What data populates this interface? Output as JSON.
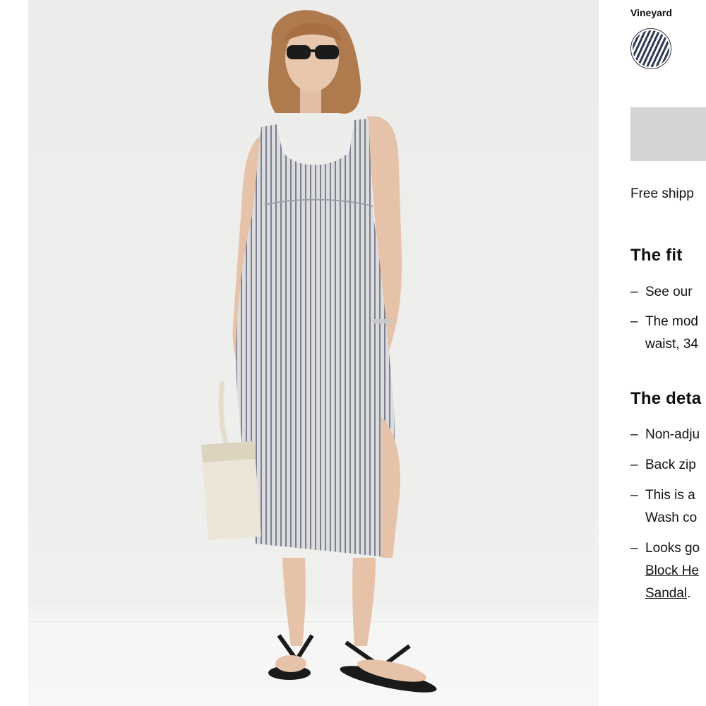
{
  "product": {
    "color_label": "Vineyard",
    "swatch": {
      "name": "Vineyard",
      "colors": [
        "#ffffff",
        "#2f3a56"
      ]
    },
    "cta_color": "#d4d4d4"
  },
  "shipping_text": "Free shipp",
  "fit": {
    "title": "The fit",
    "bullets": [
      {
        "line1": "See our "
      },
      {
        "line1": "The mod",
        "line2": "waist, 34"
      }
    ]
  },
  "details": {
    "title": "The deta",
    "bullets": [
      {
        "line1": "Non-adju"
      },
      {
        "line1": "Back zip"
      },
      {
        "line1": "This is a",
        "line2": "Wash co"
      },
      {
        "line1": "Looks go",
        "link1": "Block He",
        "link2": "Sandal",
        "suffix": "."
      }
    ]
  },
  "dash": "–",
  "photo": {
    "description_colors": {
      "background": "#eeeeec",
      "dress": "#d9d9d9",
      "stripe": "#6f7588",
      "skin": "#e6c2a8",
      "hair": "#b07a4f",
      "bag": "#ece6d8",
      "sandals": "#1a1a1a"
    }
  }
}
